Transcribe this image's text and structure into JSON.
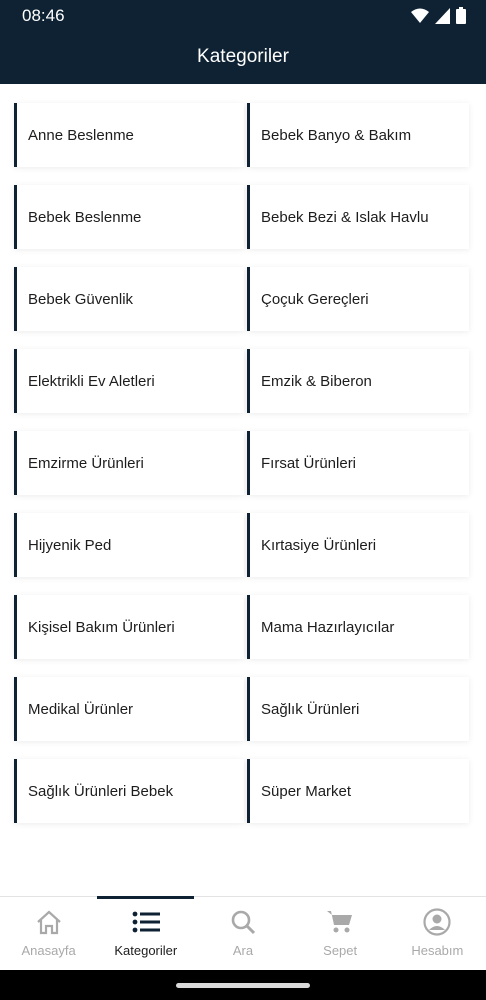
{
  "status_bar": {
    "time": "08:46"
  },
  "header": {
    "title": "Kategoriler"
  },
  "categories": [
    "Anne Beslenme",
    "Bebek Banyo & Bakım",
    "Bebek Beslenme",
    "Bebek Bezi & Islak Havlu",
    "Bebek Güvenlik",
    "Çoçuk Gereçleri",
    "Elektrikli Ev Aletleri",
    "Emzik & Biberon",
    "Emzirme Ürünleri",
    "Fırsat Ürünleri",
    "Hijyenik Ped",
    "Kırtasiye Ürünleri",
    "Kişisel Bakım Ürünleri",
    "Mama Hazırlayıcılar",
    "Medikal Ürünler",
    "Sağlık Ürünleri",
    "Sağlık Ürünleri Bebek",
    "Süper Market"
  ],
  "bottom_nav": [
    {
      "label": "Anasayfa",
      "icon": "home-icon",
      "active": false
    },
    {
      "label": "Kategoriler",
      "icon": "list-icon",
      "active": true
    },
    {
      "label": "Ara",
      "icon": "search-icon",
      "active": false
    },
    {
      "label": "Sepet",
      "icon": "cart-icon",
      "active": false
    },
    {
      "label": "Hesabım",
      "icon": "account-icon",
      "active": false
    }
  ],
  "colors": {
    "primary": "#0e2233",
    "inactive": "#a9a9a9",
    "text": "#1d1d1d"
  }
}
